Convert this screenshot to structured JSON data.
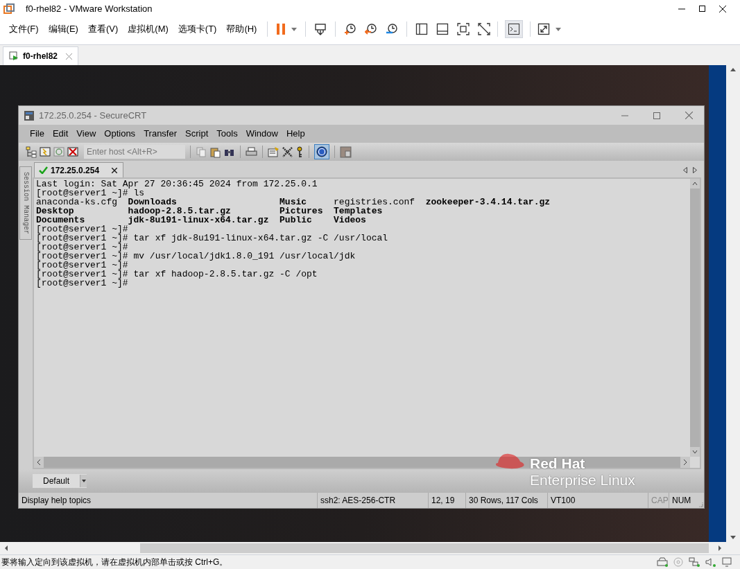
{
  "vmware": {
    "title": "f0-rhel82 - VMware Workstation",
    "menu": [
      "文件(F)",
      "编辑(E)",
      "查看(V)",
      "虚拟机(M)",
      "选项卡(T)",
      "帮助(H)"
    ],
    "tabs": [
      {
        "label": "f0-rhel82",
        "selected": true
      }
    ],
    "status_text": "要将输入定向到该虚拟机，请在虚拟机内部单击或按 Ctrl+G。"
  },
  "desktop": {
    "logo_line_1": "Red Hat",
    "logo_line_2": "Enterprise Linux"
  },
  "securecrt": {
    "title": "172.25.0.254 - SecureCRT",
    "menu": [
      "File",
      "Edit",
      "View",
      "Options",
      "Transfer",
      "Script",
      "Tools",
      "Window",
      "Help"
    ],
    "host_field": {
      "placeholder": "Enter host <Alt+R>"
    },
    "side_tab": "Session Manager",
    "tabs": [
      {
        "label": "172.25.0.254",
        "connected": true,
        "selected": true
      }
    ],
    "terminal_lines": [
      {
        "kind": "text",
        "text": "Last login: Sat Apr 27 20:36:45 2024 from 172.25.0.1"
      },
      {
        "kind": "text",
        "text": "[root@server1 ~]# ls"
      },
      {
        "kind": "listing",
        "entries": [
          {
            "text": "anaconda-ks.cfg",
            "bold": false
          },
          {
            "text": "Downloads",
            "bold": true
          },
          {
            "text": "Music",
            "bold": true
          },
          {
            "text": "registries.conf",
            "bold": false
          },
          {
            "text": "zookeeper-3.4.14.tar.gz",
            "bold": true
          }
        ]
      },
      {
        "kind": "listing",
        "entries": [
          {
            "text": "Desktop",
            "bold": true
          },
          {
            "text": "hadoop-2.8.5.tar.gz",
            "bold": true
          },
          {
            "text": "Pictures",
            "bold": true
          },
          {
            "text": "Templates",
            "bold": true
          }
        ]
      },
      {
        "kind": "listing",
        "entries": [
          {
            "text": "Documents",
            "bold": true
          },
          {
            "text": "jdk-8u191-linux-x64.tar.gz",
            "bold": true
          },
          {
            "text": "Public",
            "bold": true
          },
          {
            "text": "Videos",
            "bold": true
          }
        ]
      },
      {
        "kind": "text",
        "text": "[root@server1 ~]#"
      },
      {
        "kind": "text",
        "text": "[root@server1 ~]# tar xf jdk-8u191-linux-x64.tar.gz -C /usr/local"
      },
      {
        "kind": "text",
        "text": "[root@server1 ~]#"
      },
      {
        "kind": "text",
        "text": "[root@server1 ~]# mv /usr/local/jdk1.8.0_191 /usr/local/jdk"
      },
      {
        "kind": "text",
        "text": "[root@server1 ~]#"
      },
      {
        "kind": "text",
        "text": "[root@server1 ~]# tar xf hadoop-2.8.5.tar.gz -C /opt"
      },
      {
        "kind": "text",
        "text": "[root@server1 ~]#"
      }
    ],
    "button_bar": {
      "value": "Default"
    },
    "status_bar": [
      {
        "text": "Display help topics",
        "disabled": false
      },
      {
        "text": "ssh2: AES-256-CTR",
        "disabled": false
      },
      {
        "text": "12,  19",
        "disabled": false
      },
      {
        "text": "30 Rows, 117 Cols",
        "disabled": false
      },
      {
        "text": "VT100",
        "disabled": false
      },
      {
        "text": "CAP",
        "disabled": true
      },
      {
        "text": "NUM",
        "disabled": false
      }
    ]
  }
}
